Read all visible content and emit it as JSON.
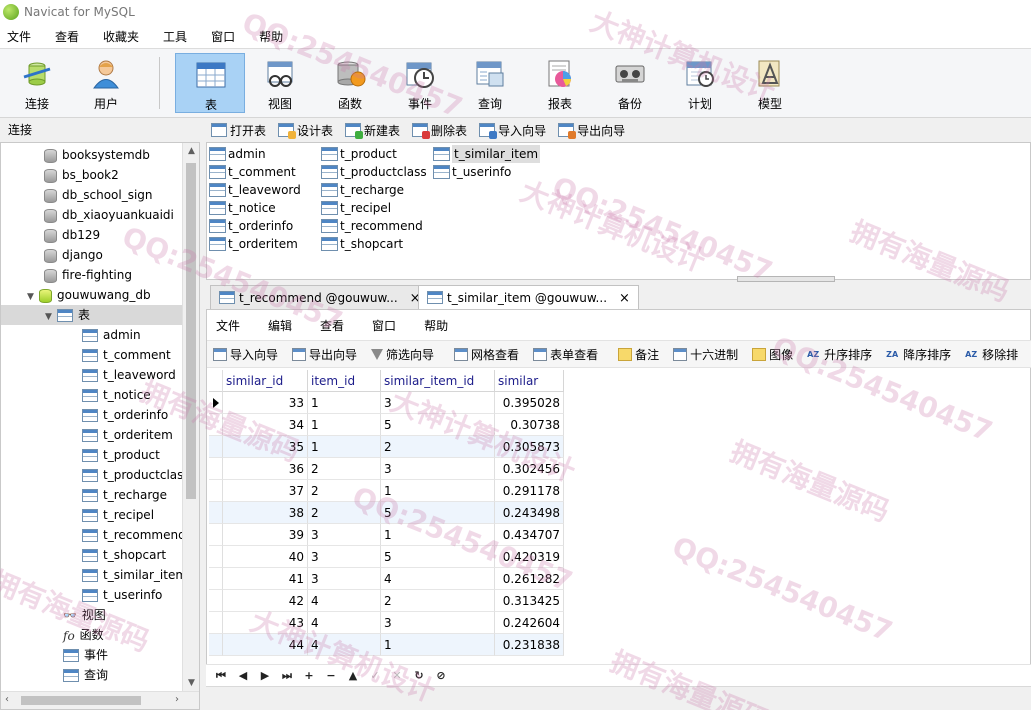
{
  "window": {
    "title": "Navicat for MySQL"
  },
  "menu": [
    "文件",
    "查看",
    "收藏夹",
    "工具",
    "窗口",
    "帮助"
  ],
  "toolbar": {
    "buttons": [
      {
        "label": "连接",
        "icon": "connection-icon"
      },
      {
        "label": "用户",
        "icon": "user-icon"
      },
      {
        "label": "表",
        "icon": "table-icon",
        "active": true
      },
      {
        "label": "视图",
        "icon": "view-icon"
      },
      {
        "label": "函数",
        "icon": "function-icon"
      },
      {
        "label": "事件",
        "icon": "event-icon"
      },
      {
        "label": "查询",
        "icon": "query-icon"
      },
      {
        "label": "报表",
        "icon": "report-icon"
      },
      {
        "label": "备份",
        "icon": "backup-icon"
      },
      {
        "label": "计划",
        "icon": "schedule-icon"
      },
      {
        "label": "模型",
        "icon": "model-icon"
      }
    ]
  },
  "sidebar": {
    "header": "连接",
    "databases": [
      "booksystemdb",
      "bs_book2",
      "db_school_sign",
      "db_xiaoyuankuaidi",
      "db129",
      "django",
      "fire-fighting"
    ],
    "open_database": "gouwuwang_db",
    "tables_group": "表",
    "tables": [
      "admin",
      "t_comment",
      "t_leaveword",
      "t_notice",
      "t_orderinfo",
      "t_orderitem",
      "t_product",
      "t_productclass",
      "t_recharge",
      "t_recipel",
      "t_recommend",
      "t_shopcart",
      "t_similar_item",
      "t_userinfo"
    ],
    "other_groups": [
      "视图",
      "函数",
      "事件",
      "查询"
    ]
  },
  "object_toolbar": [
    "打开表",
    "设计表",
    "新建表",
    "删除表",
    "导入向导",
    "导出向导"
  ],
  "table_list": {
    "columns": [
      [
        "admin",
        "t_comment",
        "t_leaveword",
        "t_notice",
        "t_orderinfo",
        "t_orderitem"
      ],
      [
        "t_product",
        "t_productclass",
        "t_recharge",
        "t_recipel",
        "t_recommend",
        "t_shopcart"
      ],
      [
        "t_similar_item",
        "t_userinfo"
      ]
    ],
    "selected": "t_similar_item"
  },
  "tabs": [
    {
      "label": "t_recommend @gouwuw...",
      "close": "×"
    },
    {
      "label": "t_similar_item @gouwuw...",
      "close": "×",
      "active": true
    }
  ],
  "grid_menu": [
    "文件",
    "编辑",
    "查看",
    "窗口",
    "帮助"
  ],
  "grid_toolbar": [
    "导入向导",
    "导出向导",
    "筛选向导",
    "网格查看",
    "表单查看",
    "备注",
    "十六进制",
    "图像",
    "升序排序",
    "降序排序",
    "移除排"
  ],
  "grid": {
    "headers": [
      "similar_id",
      "item_id",
      "similar_item_id",
      "similar"
    ],
    "rows": [
      [
        "33",
        "1",
        "3",
        "0.395028"
      ],
      [
        "34",
        "1",
        "5",
        "0.30738"
      ],
      [
        "35",
        "1",
        "2",
        "0.305873"
      ],
      [
        "36",
        "2",
        "3",
        "0.302456"
      ],
      [
        "37",
        "2",
        "1",
        "0.291178"
      ],
      [
        "38",
        "2",
        "5",
        "0.243498"
      ],
      [
        "39",
        "3",
        "1",
        "0.434707"
      ],
      [
        "40",
        "3",
        "5",
        "0.420319"
      ],
      [
        "41",
        "3",
        "4",
        "0.261282"
      ],
      [
        "42",
        "4",
        "2",
        "0.313425"
      ],
      [
        "43",
        "4",
        "3",
        "0.242604"
      ],
      [
        "44",
        "4",
        "1",
        "0.231838"
      ]
    ],
    "current_row": 0,
    "highlight_rows": [
      2,
      5,
      11
    ]
  },
  "nav": [
    "⏮",
    "◀",
    "▶",
    "⏭",
    "+",
    "−",
    "▲",
    "✓",
    "✕",
    "↻",
    "⊘"
  ],
  "watermarks": [
    "QQ:254540457",
    "大神计算机设计",
    "拥有海量源码"
  ],
  "colors": {
    "active_tool": "#a9d2f5",
    "header_text": "#1c1c8a",
    "row_alt": "#eef5fd"
  }
}
